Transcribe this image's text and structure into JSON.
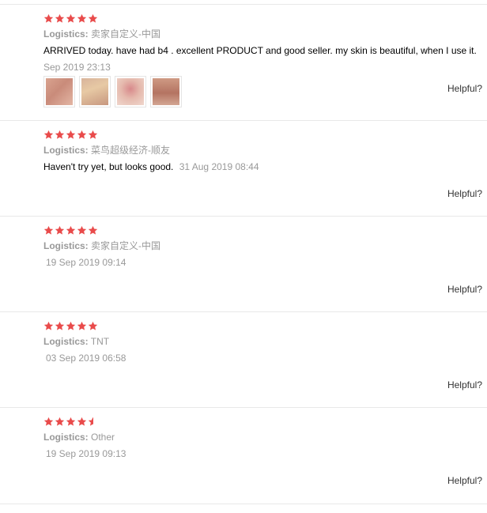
{
  "colors": {
    "star": "#e94b4b",
    "muted": "#999999",
    "divider": "#e8e8e8"
  },
  "reviews": [
    {
      "rating": 5,
      "logistics_label": "Logistics:",
      "logistics_value": "卖家自定义-中国",
      "content": "ARRIVED today. have had b4 . excellent PRODUCT and good seller. my skin is beautiful, when I use it.",
      "date": "Sep 2019 23:13",
      "images": [
        "product-photo-1",
        "product-photo-2",
        "product-photo-3",
        "product-photo-4"
      ],
      "helpful": "Helpful?"
    },
    {
      "rating": 5,
      "logistics_label": "Logistics:",
      "logistics_value": "菜鸟超级经济-顺友",
      "content": "Haven't try yet, but looks good.",
      "date": "31 Aug 2019 08:44",
      "helpful": "Helpful?"
    },
    {
      "rating": 5,
      "logistics_label": "Logistics:",
      "logistics_value": "卖家自定义-中国",
      "date": "19 Sep 2019 09:14",
      "helpful": "Helpful?"
    },
    {
      "rating": 5,
      "logistics_label": "Logistics:",
      "logistics_value": "TNT",
      "date": "03 Sep 2019 06:58",
      "helpful": "Helpful?"
    },
    {
      "rating": 4.5,
      "logistics_label": "Logistics:",
      "logistics_value": "Other",
      "date": "19 Sep 2019 09:13",
      "helpful": "Helpful?"
    }
  ]
}
